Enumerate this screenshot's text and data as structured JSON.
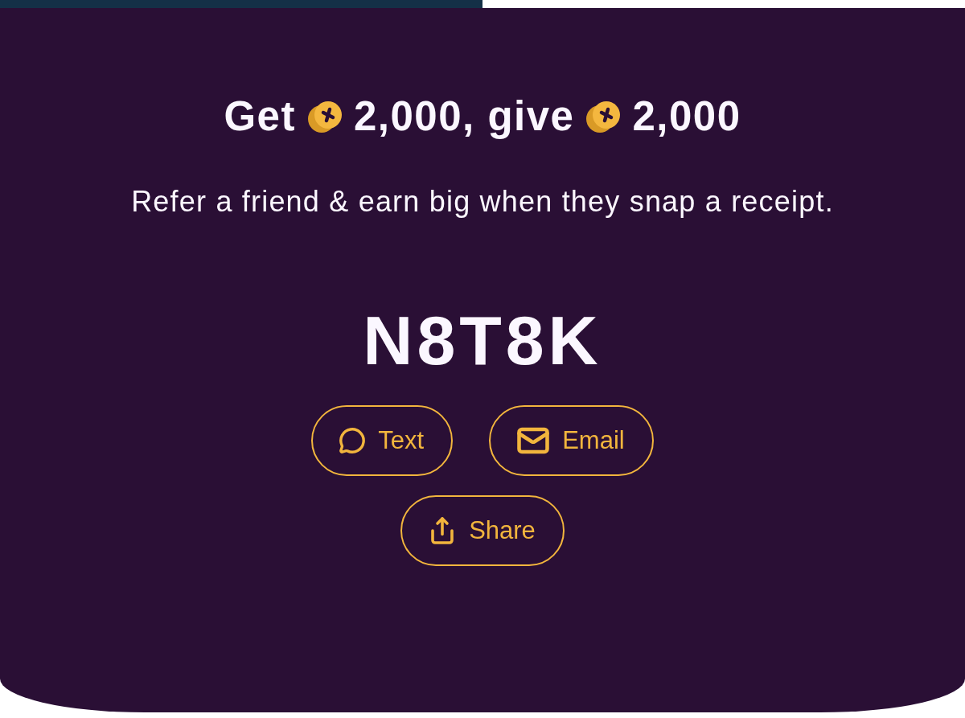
{
  "progress": {
    "level": 0.5
  },
  "title": {
    "parts": [
      {
        "kind": "text",
        "text": "Get"
      },
      {
        "kind": "coin"
      },
      {
        "kind": "text",
        "text": "2,000, give"
      },
      {
        "kind": "coin"
      },
      {
        "kind": "text",
        "text": "2,000"
      }
    ]
  },
  "subtitle": "Refer a friend & earn big when they snap a receipt.",
  "code": "N8T8K",
  "share_options": [
    {
      "kind": "text",
      "label": "Text"
    },
    {
      "kind": "email",
      "label": "Email"
    },
    {
      "kind": "share",
      "label": "Share"
    }
  ]
}
